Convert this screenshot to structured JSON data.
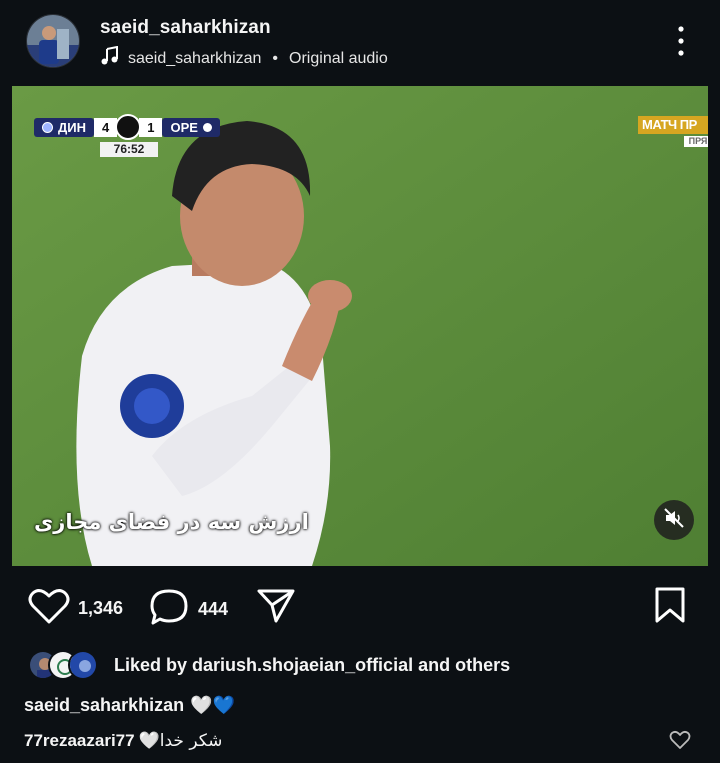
{
  "post": {
    "username": "saeid_saharkhizan",
    "audio_user": "saeid_saharkhizan",
    "audio_separator": "•",
    "audio_label": "Original audio"
  },
  "video": {
    "scoreboard": {
      "home_team": "ДИН",
      "home_score": "4",
      "away_score": "1",
      "away_team": "ОРЕ",
      "match_time": "76:52"
    },
    "channel": "МАТЧ ПР",
    "channel_sub": "ПРЯ",
    "subtitle": "ارزش سه در فضای مجازی",
    "muted": true
  },
  "actions": {
    "likes": "1,346",
    "comments": "444"
  },
  "liked_by": {
    "text": "Liked by dariush.shojaeian_official and others"
  },
  "caption": {
    "username": "saeid_saharkhizan",
    "emojis": "🤍💙"
  },
  "comment": {
    "username": "77rezaazari77",
    "text": "شکر خدا🤍"
  },
  "colors": {
    "background": "#0c1014",
    "text": "#f5f5f5",
    "pitch": "#5a8a3c",
    "blue_heart": "#3897f0"
  },
  "icons": [
    "music-note-icon",
    "more-options-icon",
    "muted-speaker-icon",
    "heart-icon",
    "comment-bubble-icon",
    "share-paper-plane-icon",
    "bookmark-icon",
    "small-heart-icon"
  ]
}
